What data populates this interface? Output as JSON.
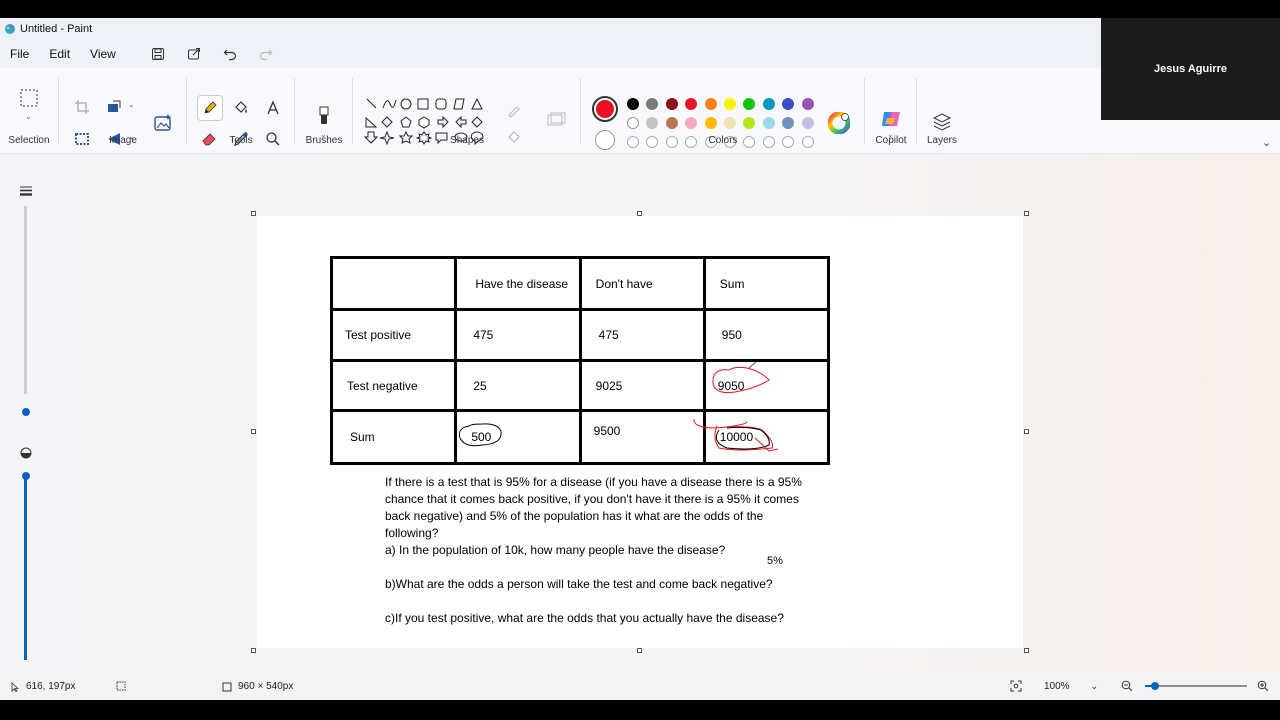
{
  "window": {
    "title": "Untitled - Paint"
  },
  "menu": [
    "File",
    "Edit",
    "View"
  ],
  "ribbon": {
    "groups": {
      "selection": "Selection",
      "image": "Image",
      "tools": "Tools",
      "brushes": "Brushes",
      "shapes": "Shapes",
      "colors": "Colors",
      "copilot": "Copilot",
      "layers": "Layers"
    },
    "active_color": "#e81224",
    "palette_row1": [
      "#000000",
      "#7a7a7a",
      "#8b0e1a",
      "#e81224",
      "#f7821b",
      "#fff000",
      "#16c60c",
      "#0099bc",
      "#3b4ec4",
      "#9b4fb5"
    ],
    "palette_row2": [
      "#ffffff",
      "#c3c3c3",
      "#b6794c",
      "#f7a9c0",
      "#fcb908",
      "#efe4b0",
      "#b5e61d",
      "#99d9ea",
      "#7092be",
      "#c8bfe7"
    ]
  },
  "webcam": {
    "name": "Jesus Aguirre"
  },
  "canvas": {
    "table": [
      [
        "",
        "Have the disease",
        "Don't have",
        "Sum"
      ],
      [
        "Test positive",
        "475",
        "475",
        "950"
      ],
      [
        "Test negative",
        "25",
        "9025",
        "9050"
      ],
      [
        "Sum",
        "500",
        "9500",
        "10000"
      ]
    ],
    "question": [
      "If there is a test that is 95% for a disease (if you have a disease there is a 95% chance that it comes back positive, if you don't have it there is a 95% it comes back negative) and 5% of the population has it what are the odds of the following?",
      "a) In the population of 10k, how many people have the disease?",
      "",
      "b)What are the odds a person will take the test and come back negative?",
      "",
      "c)If you test positive, what are the odds that you actually have the disease?"
    ],
    "side_note": "5%"
  },
  "status": {
    "cursor_pos": "616, 197px",
    "canvas_size": "960 × 540px",
    "zoom": "100%",
    "zoom_level": 0.1
  }
}
